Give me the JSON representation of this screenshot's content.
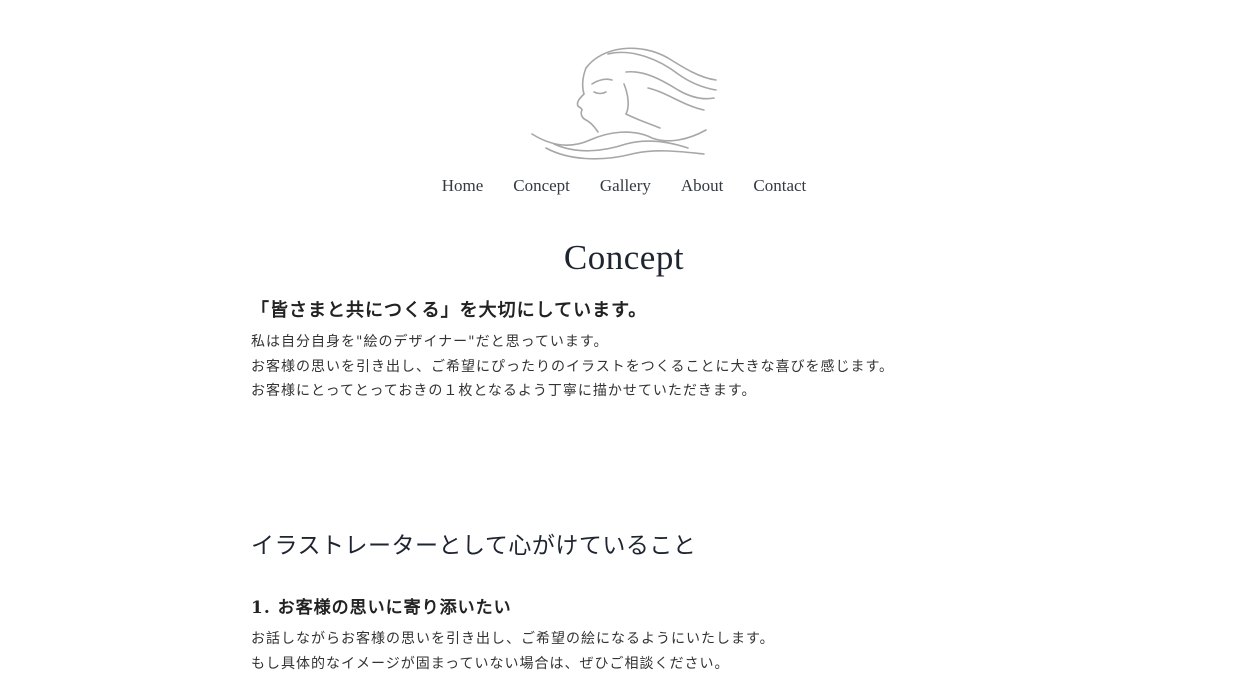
{
  "logo": {
    "icon": "woman-profile-line-art-logo"
  },
  "nav": {
    "items": [
      {
        "label": "Home"
      },
      {
        "label": "Concept"
      },
      {
        "label": "Gallery"
      },
      {
        "label": "About"
      },
      {
        "label": "Contact"
      }
    ]
  },
  "page": {
    "title": "Concept",
    "lead": "「皆さまと共につくる」を大切にしています。",
    "intro_lines": [
      "私は自分自身を\"絵のデザイナー\"だと思っています。",
      "お客様の思いを引き出し、ご希望にぴったりのイラストをつくることに大きな喜びを感じます。",
      "お客様にとってとっておきの１枚となるよう丁寧に描かせていただきます。"
    ]
  },
  "section": {
    "heading": "イラストレーターとして心がけていること",
    "items": [
      {
        "title": "1. お客様の思いに寄り添いたい",
        "lines": [
          "お話しながらお客様の思いを引き出し、ご希望の絵になるようにいたします。",
          "もし具体的なイメージが固まっていない場合は、ぜひご相談ください。"
        ]
      }
    ]
  }
}
